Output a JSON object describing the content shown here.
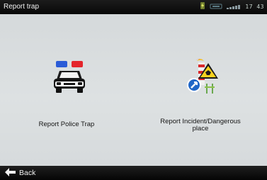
{
  "header": {
    "title": "Report trap",
    "status_icons": [
      "battery-charging-icon",
      "gps-icon",
      "signal-icon"
    ],
    "clock": "17 43"
  },
  "options": [
    {
      "label": "Report Police Trap",
      "icon": "police-car-icon"
    },
    {
      "label_line1": "Report Incident/Dangerous",
      "label_line2": "place",
      "icon": "incident-warning-icon"
    }
  ],
  "footer": {
    "back_label": "Back",
    "back_icon": "arrow-left-icon"
  },
  "colors": {
    "bar_bg": "#0b0b0b",
    "content_bg": "#dde1e2",
    "accent_green": "#7cc576"
  }
}
